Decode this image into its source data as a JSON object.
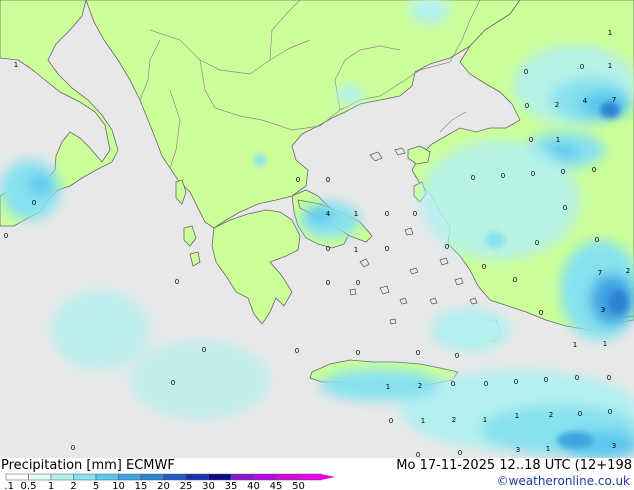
{
  "map": {
    "value_labels": [
      {
        "t": "1"
      },
      {
        "t": "0"
      },
      {
        "t": "0"
      },
      {
        "t": "1"
      },
      {
        "t": "0"
      },
      {
        "t": "2"
      },
      {
        "t": "4"
      },
      {
        "t": "7"
      },
      {
        "t": "0"
      },
      {
        "t": "1"
      },
      {
        "t": "0"
      },
      {
        "t": "0"
      },
      {
        "t": "0"
      },
      {
        "t": "0"
      },
      {
        "t": "0"
      },
      {
        "t": "0"
      },
      {
        "t": "0"
      },
      {
        "t": "0"
      },
      {
        "t": "0"
      },
      {
        "t": "0"
      },
      {
        "t": "0"
      },
      {
        "t": "4"
      },
      {
        "t": "1"
      },
      {
        "t": "0"
      },
      {
        "t": "0"
      },
      {
        "t": "0"
      },
      {
        "t": "0"
      },
      {
        "t": "1"
      },
      {
        "t": "0"
      },
      {
        "t": "0"
      },
      {
        "t": "0"
      },
      {
        "t": "0"
      },
      {
        "t": "0"
      },
      {
        "t": "0"
      },
      {
        "t": "0"
      },
      {
        "t": "0"
      },
      {
        "t": "7"
      },
      {
        "t": "2"
      },
      {
        "t": "3"
      },
      {
        "t": "0"
      },
      {
        "t": "0"
      },
      {
        "t": "0"
      },
      {
        "t": "0"
      },
      {
        "t": "0"
      },
      {
        "t": "1"
      },
      {
        "t": "1"
      },
      {
        "t": "1"
      },
      {
        "t": "2"
      },
      {
        "t": "0"
      },
      {
        "t": "0"
      },
      {
        "t": "0"
      },
      {
        "t": "0"
      },
      {
        "t": "0"
      },
      {
        "t": "0"
      },
      {
        "t": "0"
      },
      {
        "t": "0"
      },
      {
        "t": "1"
      },
      {
        "t": "1"
      },
      {
        "t": "2"
      },
      {
        "t": "0"
      },
      {
        "t": "0"
      },
      {
        "t": "2"
      },
      {
        "t": "1"
      },
      {
        "t": "1"
      },
      {
        "t": "0"
      },
      {
        "t": "3"
      },
      {
        "t": "3"
      },
      {
        "t": "1"
      },
      {
        "t": "0"
      },
      {
        "t": "0"
      }
    ]
  },
  "footer": {
    "title": "Precipitation [mm]  ECMWF",
    "datetime": "Mo 17-11-2025 12..18 UTC (12+198",
    "credit": "©weatheronline.co.uk",
    "scale": [
      {
        "label": "0.1",
        "color": "#ffffff"
      },
      {
        "label": "0.5",
        "color": "#e1fafa"
      },
      {
        "label": "1",
        "color": "#b4f0f0"
      },
      {
        "label": "2",
        "color": "#87e1ef"
      },
      {
        "label": "5",
        "color": "#5ac8ee"
      },
      {
        "label": "10",
        "color": "#3ca5e1"
      },
      {
        "label": "15",
        "color": "#2d82d2"
      },
      {
        "label": "20",
        "color": "#1e5ac8"
      },
      {
        "label": "25",
        "color": "#1432aa"
      },
      {
        "label": "30",
        "color": "#0a0a8c"
      },
      {
        "label": "35",
        "color": "#8c14d2"
      },
      {
        "label": "40",
        "color": "#b40ae6"
      },
      {
        "label": "45",
        "color": "#d20ad2"
      },
      {
        "label": "50",
        "color": "#e600e6"
      }
    ]
  },
  "colors": {
    "sea": "#e8e8e8",
    "land": "#ccff99",
    "border": "#8a8a8a",
    "coast": "#666666"
  }
}
